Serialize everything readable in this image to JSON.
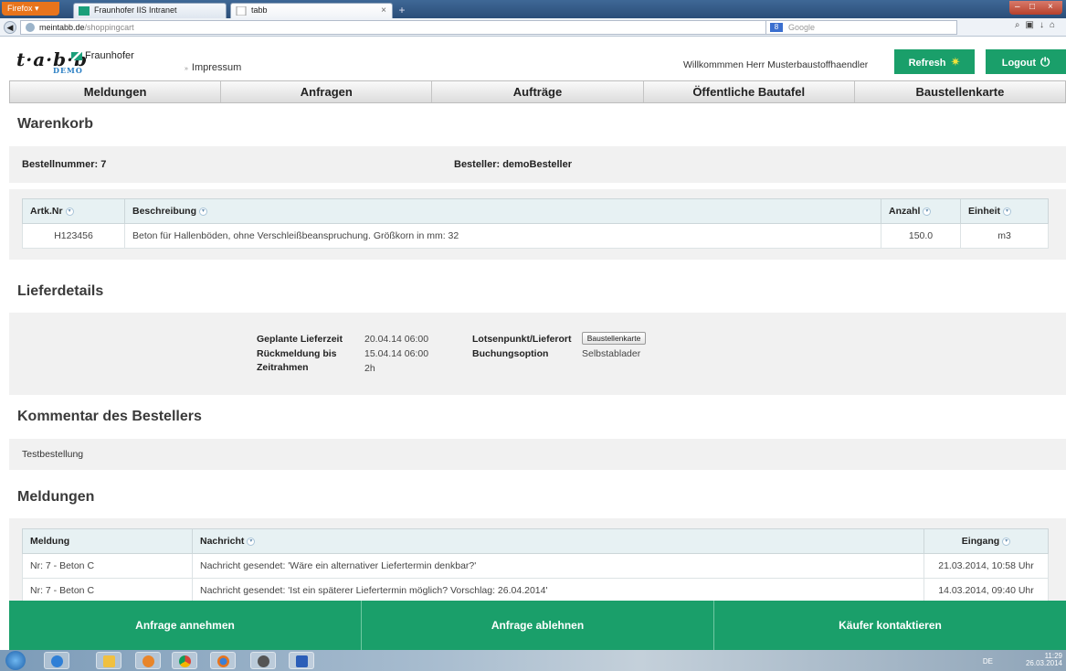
{
  "browser": {
    "app_button": "Firefox",
    "tabs": [
      {
        "label": "Fraunhofer IIS Intranet"
      },
      {
        "label": "tabb"
      }
    ],
    "new_tab": "+",
    "url_domain": "meintabb.de",
    "url_path": "/shoppingcart",
    "search_placeholder": "Google"
  },
  "header": {
    "logo_text": "t·a·b·b",
    "logo_badge": "DEMO",
    "partner": "Fraunhofer",
    "impressum": "Impressum",
    "welcome": "Willkommmen Herr Musterbaustoffhaendler",
    "refresh_label": "Refresh",
    "logout_label": "Logout"
  },
  "nav": {
    "items": [
      "Meldungen",
      "Anfragen",
      "Aufträge",
      "Öffentliche Bautafel",
      "Baustellenkarte"
    ]
  },
  "cart": {
    "title": "Warenkorb",
    "order_number": "Bestellnummer: 7",
    "orderer": "Besteller: demoBesteller",
    "columns": [
      "Artk.Nr",
      "Beschreibung",
      "Anzahl",
      "Einheit"
    ],
    "rows": [
      {
        "artnr": "H123456",
        "beschreibung": "Beton für Hallenböden, ohne Verschleißbeanspruchung. Größkorn in mm: 32",
        "anzahl": "150.0",
        "einheit": "m3"
      }
    ]
  },
  "delivery": {
    "title": "Lieferdetails",
    "labels": {
      "planned_time": "Geplante Lieferzeit",
      "feedback_until": "Rückmeldung bis",
      "timeframe": "Zeitrahmen",
      "location": "Lotsenpunkt/Lieferort",
      "booking": "Buchungsoption"
    },
    "values": {
      "planned_time": "20.04.14 06:00",
      "feedback_until": "15.04.14 06:00",
      "timeframe": "2h",
      "location_button": "Baustellenkarte",
      "booking": "Selbstablader"
    }
  },
  "comment": {
    "title": "Kommentar des Bestellers",
    "text": "Testbestellung"
  },
  "messages": {
    "title": "Meldungen",
    "columns": [
      "Meldung",
      "Nachricht",
      "Eingang"
    ],
    "rows": [
      {
        "meldung": "Nr: 7 - Beton C",
        "nachricht": "Nachricht gesendet: 'Wäre ein alternativer Liefertermin denkbar?'",
        "eingang": "21.03.2014, 10:58 Uhr"
      },
      {
        "meldung": "Nr: 7 - Beton C",
        "nachricht": "Nachricht gesendet: 'Ist ein späterer Liefertermin möglich? Vorschlag: 26.04.2014'",
        "eingang": "14.03.2014, 09:40 Uhr"
      }
    ]
  },
  "actions": {
    "accept": "Anfrage annehmen",
    "reject": "Anfrage ablehnen",
    "contact": "Käufer kontaktieren"
  },
  "taskbar": {
    "lang": "DE",
    "time": "11:29",
    "date": "26.03.2014"
  },
  "colors": {
    "accent_green": "#1a9f6a",
    "table_header": "#e7f1f3",
    "panel_gray": "#f1f1f1"
  }
}
